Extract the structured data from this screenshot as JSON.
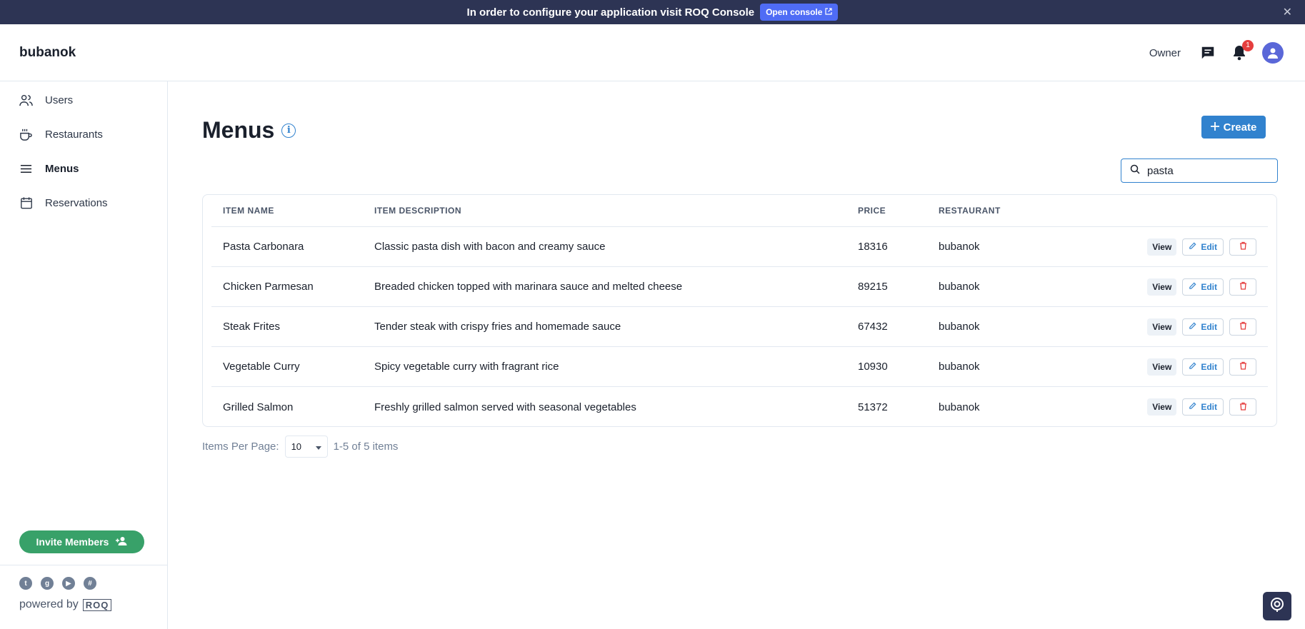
{
  "banner": {
    "text": "In order to configure your application visit ROQ Console",
    "button_label": "Open console",
    "button_icon": "external-link-icon",
    "close_icon": "close-icon"
  },
  "header": {
    "brand": "bubanok",
    "role": "Owner",
    "notification_count": "1"
  },
  "sidebar": {
    "items": [
      {
        "label": "Users",
        "icon": "users-icon"
      },
      {
        "label": "Restaurants",
        "icon": "cup-icon"
      },
      {
        "label": "Menus",
        "icon": "menu-icon",
        "active": true
      },
      {
        "label": "Reservations",
        "icon": "calendar-icon"
      }
    ],
    "invite_label": "Invite Members",
    "socials": [
      "twitter-icon",
      "github-icon",
      "youtube-icon",
      "slack-icon"
    ],
    "powered_by": "powered by",
    "logo_text": "ROQ"
  },
  "main": {
    "title": "Menus",
    "create_label": "Create",
    "search_value": "pasta",
    "columns": [
      "ITEM NAME",
      "ITEM DESCRIPTION",
      "PRICE",
      "RESTAURANT"
    ],
    "rows": [
      {
        "name": "Pasta Carbonara",
        "description": "Classic pasta dish with bacon and creamy sauce",
        "price": "18316",
        "restaurant": "bubanok"
      },
      {
        "name": "Chicken Parmesan",
        "description": "Breaded chicken topped with marinara sauce and melted cheese",
        "price": "89215",
        "restaurant": "bubanok"
      },
      {
        "name": "Steak Frites",
        "description": "Tender steak with crispy fries and homemade sauce",
        "price": "67432",
        "restaurant": "bubanok"
      },
      {
        "name": "Vegetable Curry",
        "description": "Spicy vegetable curry with fragrant rice",
        "price": "10930",
        "restaurant": "bubanok"
      },
      {
        "name": "Grilled Salmon",
        "description": "Freshly grilled salmon served with seasonal vegetables",
        "price": "51372",
        "restaurant": "bubanok"
      }
    ],
    "actions": {
      "view": "View",
      "edit": "Edit"
    },
    "pager": {
      "label": "Items Per Page:",
      "per_page": "10",
      "summary": "1-5 of 5 items"
    }
  },
  "colors": {
    "banner_bg": "#2d3454",
    "accent": "#3182ce",
    "invite_green": "#38a169",
    "danger": "#e53e3e"
  }
}
